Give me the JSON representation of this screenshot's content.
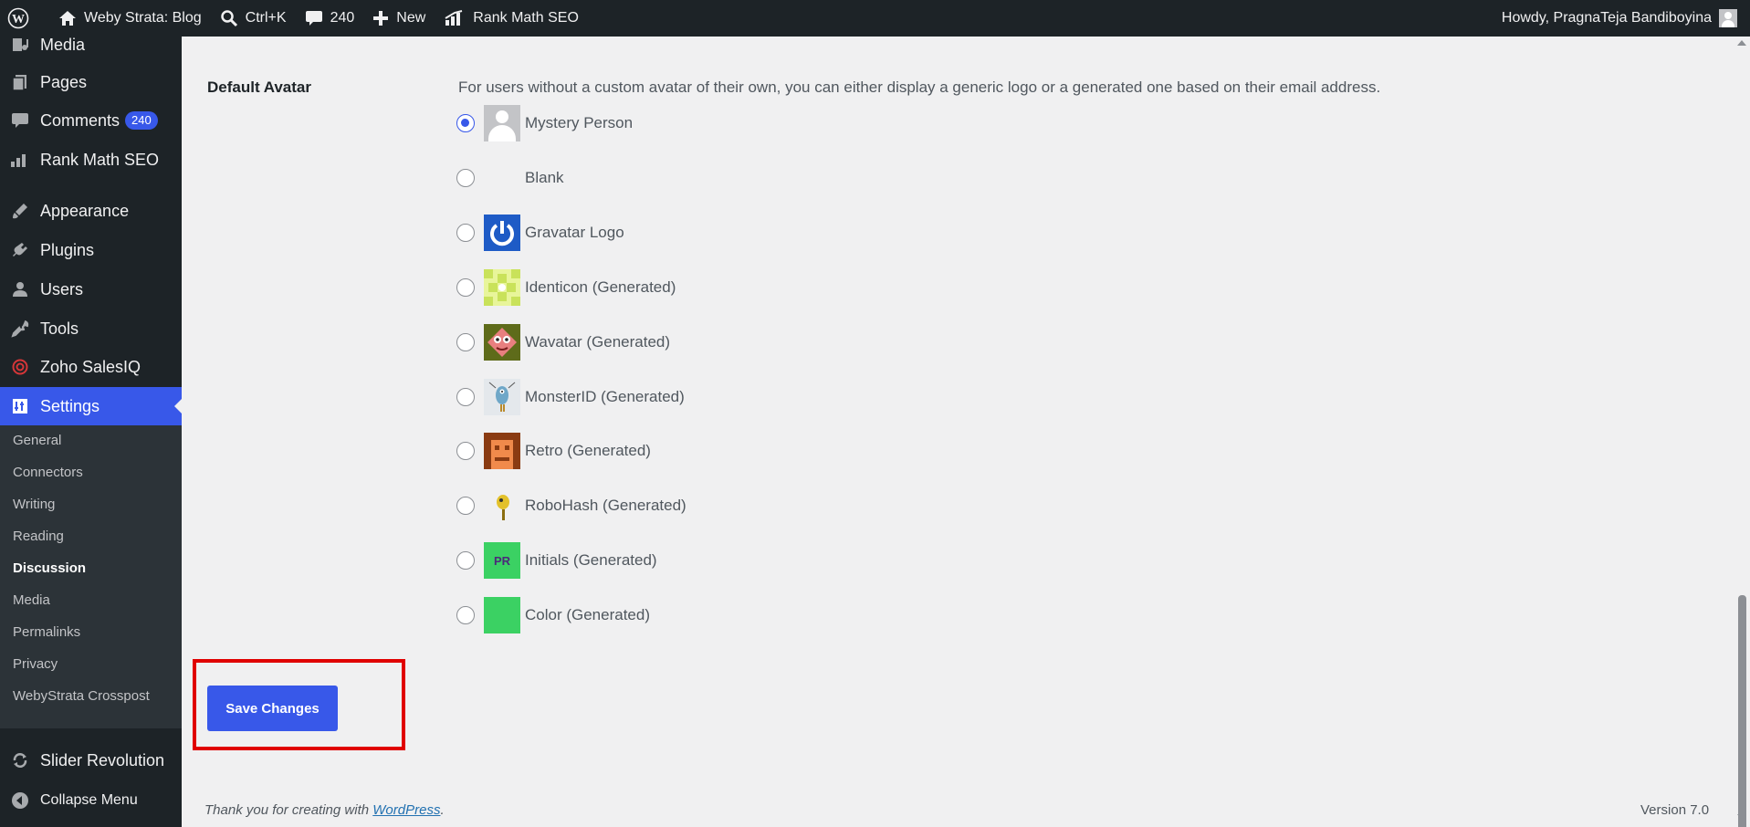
{
  "adminbar": {
    "site_name": "Weby Strata: Blog",
    "search_shortcut": "Ctrl+K",
    "comments_count": "240",
    "new_label": "New",
    "rankmath_label": "Rank Math SEO",
    "howdy": "Howdy, PragnaTeja Bandiboyina"
  },
  "sidebar": {
    "items": [
      {
        "label": "Media",
        "icon": "media-icon"
      },
      {
        "label": "Pages",
        "icon": "pages-icon"
      },
      {
        "label": "Comments",
        "icon": "comments-icon",
        "badge": "240"
      },
      {
        "label": "Rank Math SEO",
        "icon": "rankmath-icon"
      },
      {
        "label": "Appearance",
        "icon": "appearance-icon"
      },
      {
        "label": "Plugins",
        "icon": "plugins-icon"
      },
      {
        "label": "Users",
        "icon": "users-icon"
      },
      {
        "label": "Tools",
        "icon": "tools-icon"
      },
      {
        "label": "Zoho SalesIQ",
        "icon": "zoho-icon"
      },
      {
        "label": "Settings",
        "icon": "settings-icon"
      },
      {
        "label": "Slider Revolution",
        "icon": "slider-revolution-icon"
      },
      {
        "label": "Collapse Menu",
        "icon": "collapse-icon"
      }
    ],
    "submenu": [
      "General",
      "Connectors",
      "Writing",
      "Reading",
      "Discussion",
      "Media",
      "Permalinks",
      "Privacy",
      "WebyStrata Crosspost"
    ],
    "active_submenu": "Discussion"
  },
  "main": {
    "section_label": "Default Avatar",
    "description": "For users without a custom avatar of their own, you can either display a generic logo or a generated one based on their email address.",
    "avatar_options": [
      {
        "label": "Mystery Person",
        "checked": true
      },
      {
        "label": "Blank",
        "checked": false
      },
      {
        "label": "Gravatar Logo",
        "checked": false
      },
      {
        "label": "Identicon (Generated)",
        "checked": false
      },
      {
        "label": "Wavatar (Generated)",
        "checked": false
      },
      {
        "label": "MonsterID (Generated)",
        "checked": false
      },
      {
        "label": "Retro (Generated)",
        "checked": false
      },
      {
        "label": "RoboHash (Generated)",
        "checked": false
      },
      {
        "label": "Initials (Generated)",
        "checked": false
      },
      {
        "label": "Color (Generated)",
        "checked": false
      }
    ],
    "initials_text": "PR",
    "save_label": "Save Changes"
  },
  "footer": {
    "thanks_prefix": "Thank you for creating with ",
    "thanks_link": "WordPress",
    "thanks_suffix": ".",
    "version": "Version 7.0"
  },
  "colors": {
    "accent": "#3858e9",
    "highlight_box": "#e00000",
    "adminbar_bg": "#1d2327"
  }
}
